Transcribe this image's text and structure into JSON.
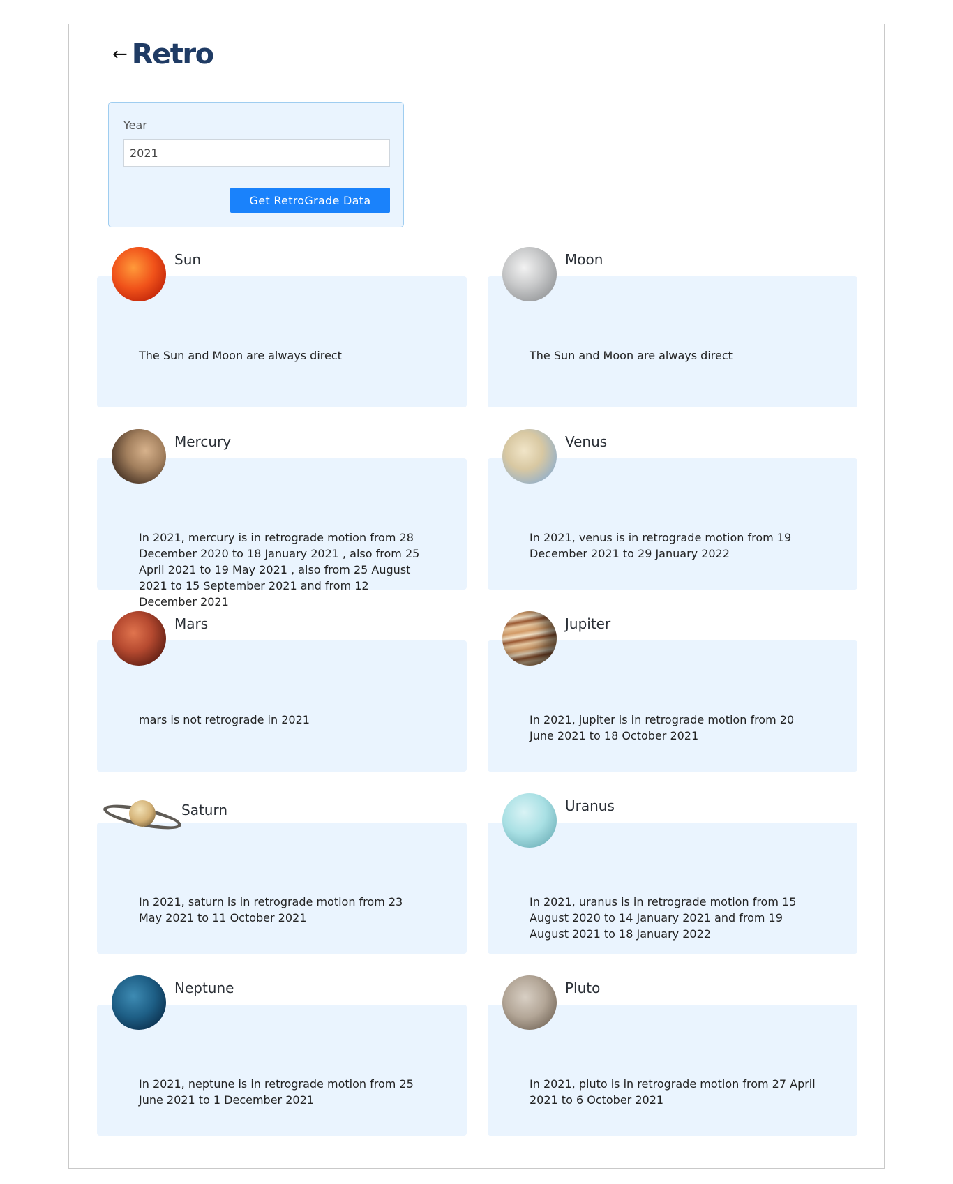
{
  "header": {
    "back_icon": "arrow-left-icon",
    "title": "Retro"
  },
  "form": {
    "year_label": "Year",
    "year_value": "2021",
    "submit_label": "Get RetroGrade Data"
  },
  "planets": [
    {
      "name": "Sun",
      "icon": "sun-icon",
      "text": "The Sun and Moon are always direct"
    },
    {
      "name": "Moon",
      "icon": "moon-icon",
      "text": "The Sun and Moon are always direct"
    },
    {
      "name": "Mercury",
      "icon": "mercury-icon",
      "text": "In 2021, mercury is in retrograde motion from 28 December 2020 to 18 January 2021 , also from 25 April 2021 to 19 May 2021 , also from 25 August 2021 to 15 September 2021 and from 12 December 2021"
    },
    {
      "name": "Venus",
      "icon": "venus-icon",
      "text": "In 2021, venus is in retrograde motion from 19 December 2021 to 29 January 2022"
    },
    {
      "name": "Mars",
      "icon": "mars-icon",
      "text": "mars is not retrograde in 2021"
    },
    {
      "name": "Jupiter",
      "icon": "jupiter-icon",
      "text": "In 2021, jupiter is in retrograde motion from 20 June 2021 to 18 October 2021"
    },
    {
      "name": "Saturn",
      "icon": "saturn-icon",
      "text": "In 2021, saturn is in retrograde motion from 23 May 2021 to 11 October 2021"
    },
    {
      "name": "Uranus",
      "icon": "uranus-icon",
      "text": "In 2021, uranus is in retrograde motion from 15 August 2020 to 14 January 2021 and from 19 August 2021 to 18 January 2022"
    },
    {
      "name": "Neptune",
      "icon": "neptune-icon",
      "text": "In 2021, neptune is in retrograde motion from 25 June 2021 to 1 December 2021"
    },
    {
      "name": "Pluto",
      "icon": "pluto-icon",
      "text": "In 2021, pluto is in retrograde motion from 27 April 2021 to 6 October 2021"
    }
  ]
}
